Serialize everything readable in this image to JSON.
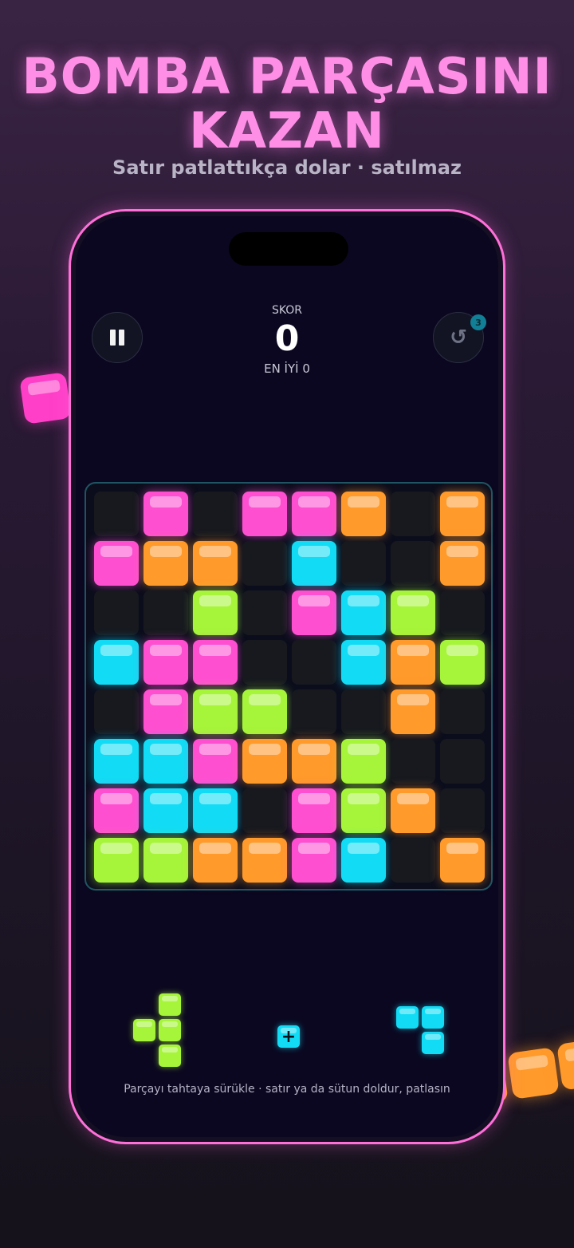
{
  "header": {
    "title": "BOMBA PARÇASINI KAZAN",
    "subtitle": "Satır patlattıkça dolar · satılmaz"
  },
  "colors": {
    "accent_pink": "#ff4fd1",
    "orange": "#ff9a2b",
    "cyan": "#12dcf5",
    "lime": "#a6f53a",
    "empty_cell": "#17191f",
    "phone_frame": "#ff6fd8"
  },
  "game": {
    "score_label": "SKOR",
    "score_value": "0",
    "best_label": "EN İYİ 0",
    "pause_icon": "pause-icon",
    "undo_icon": "undo-icon",
    "undo_count": "3"
  },
  "board": {
    "size": 8,
    "rows": [
      [
        "",
        "P",
        "",
        "P",
        "P",
        "O",
        "",
        "O"
      ],
      [
        "P",
        "O",
        "O",
        "",
        "C",
        "",
        "",
        "O"
      ],
      [
        "",
        "",
        "L",
        "",
        "P",
        "C",
        "L",
        ""
      ],
      [
        "C",
        "P",
        "P",
        "",
        "",
        "C",
        "O",
        "L"
      ],
      [
        "",
        "P",
        "L",
        "L",
        "",
        "",
        "O",
        ""
      ],
      [
        "C",
        "C",
        "P",
        "O",
        "O",
        "L",
        "",
        ""
      ],
      [
        "P",
        "C",
        "C",
        "",
        "P",
        "L",
        "O",
        ""
      ],
      [
        "L",
        "L",
        "O",
        "O",
        "P",
        "C",
        "",
        "O"
      ]
    ]
  },
  "tray": {
    "pieces": [
      {
        "name": "lime-t-piece",
        "color": "L",
        "cells": [
          [
            1,
            0
          ],
          [
            0,
            1
          ],
          [
            1,
            1
          ],
          [
            1,
            2
          ]
        ]
      },
      {
        "name": "cyan-bomb-piece",
        "color": "C",
        "cells": [
          [
            0,
            0
          ]
        ],
        "icon": "plus-icon"
      },
      {
        "name": "cyan-l-piece",
        "color": "C",
        "cells": [
          [
            0,
            0
          ],
          [
            1,
            0
          ],
          [
            1,
            1
          ]
        ]
      }
    ],
    "hint": "Parçayı tahtaya sürükle · satır ya da sütun doldur, patlasın"
  }
}
